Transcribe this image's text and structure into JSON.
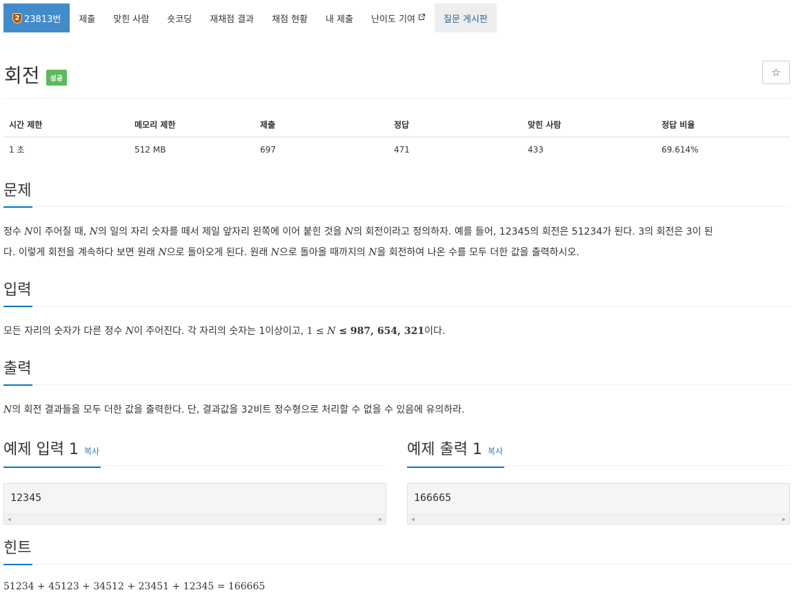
{
  "nav": {
    "problem_number": "23813번",
    "tier_badge": "2",
    "items": [
      "제출",
      "맞힌 사람",
      "숏코딩",
      "재채점 결과",
      "채점 현황",
      "내 제출",
      "난이도 기여"
    ],
    "board": "질문 게시판"
  },
  "title": "회전",
  "status_badge": "성공",
  "star_icon": "☆",
  "info": {
    "headers": [
      "시간 제한",
      "메모리 제한",
      "제출",
      "정답",
      "맞힌 사람",
      "정답 비율"
    ],
    "values": [
      "1 초",
      "512 MB",
      "697",
      "471",
      "433",
      "69.614%"
    ]
  },
  "sections": {
    "problem": {
      "title": "문제",
      "p1": "정수 ",
      "p2": "이 주어질 때, ",
      "p3": "의 일의 자리 숫자를 떼서 제일 앞자리 왼쪽에 이어 붙힌 것을 ",
      "p4": "의 회전이라고 정의하자. 예를 들어, 12345의 회전은 51234가 된다. 3의 회전은 3이 된",
      "p5": "다. 이렇게 회전을 계속하다 보면 원래 ",
      "p6": "으로 돌아오게 된다. 원래 ",
      "p7": "으로 돌아올 때까지의 ",
      "p8": "을 회전하여 나온 수를 모두 더한 값을 출력하시오."
    },
    "input": {
      "title": "입력",
      "p1": "모든 자리의 숫자가 다른 정수 ",
      "p2": "이 주어진다. 각 자리의 숫자는 1이상이고, ",
      "math": "1 ≤ ",
      "math2": " ≤ 987, 654, 321",
      "p3": "이다."
    },
    "output": {
      "title": "출력",
      "p1": "의 회전 결과들을 모두 더한 값을 출력한다. 단, 결과값을 32비트 정수형으로 처리할 수 없을 수 있음에 유의하라."
    },
    "hint": {
      "title": "힌트",
      "formula": "51234 + 45123 + 34512 + 23451 + 12345 = 166665"
    }
  },
  "var_n": "N",
  "examples": {
    "input_title": "예제 입력 1",
    "output_title": "예제 출력 1",
    "copy_label": "복사",
    "input_value": "12345",
    "output_value": "166665"
  }
}
